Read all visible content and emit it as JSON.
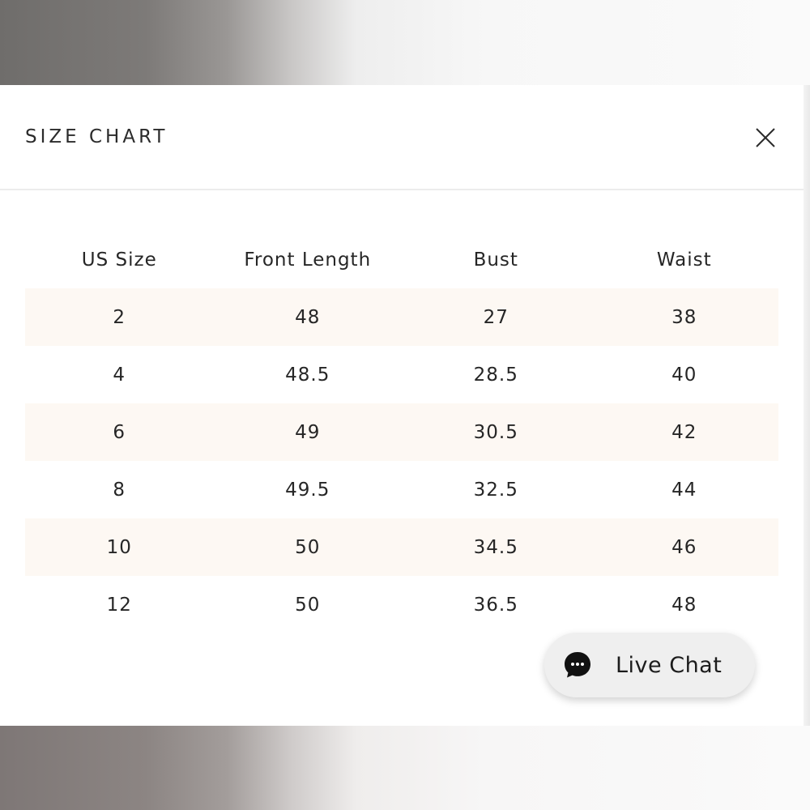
{
  "modal": {
    "title": "SIZE CHART",
    "close_icon": "close-icon"
  },
  "table": {
    "headers": [
      "US Size",
      "Front Length",
      "Bust",
      "Waist"
    ],
    "rows": [
      [
        "2",
        "48",
        "27",
        "38"
      ],
      [
        "4",
        "48.5",
        "28.5",
        "40"
      ],
      [
        "6",
        "49",
        "30.5",
        "42"
      ],
      [
        "8",
        "49.5",
        "32.5",
        "44"
      ],
      [
        "10",
        "50",
        "34.5",
        "46"
      ],
      [
        "12",
        "50",
        "36.5",
        "48"
      ]
    ],
    "shaded_row_color": "#fdf8f3"
  },
  "live_chat": {
    "label": "Live Chat",
    "icon": "chat-bubble-icon",
    "icon_color": "#111111"
  }
}
